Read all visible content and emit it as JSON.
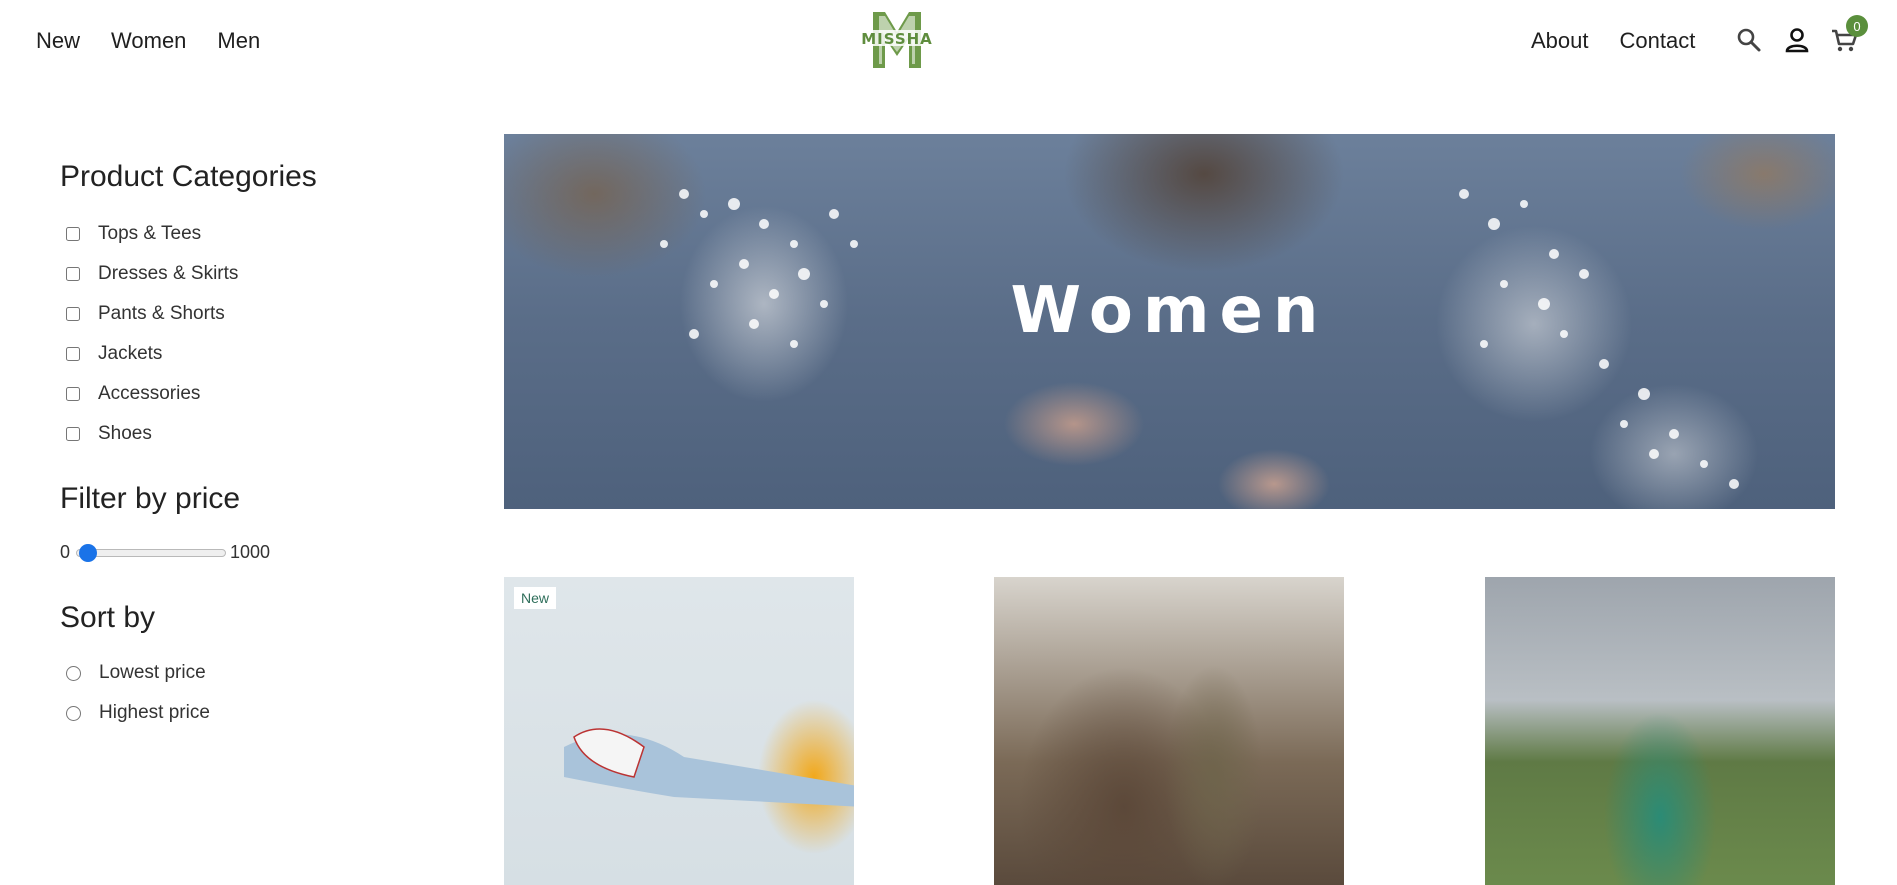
{
  "nav": {
    "left": [
      "New",
      "Women",
      "Men"
    ],
    "right": [
      "About",
      "Contact"
    ],
    "cart_count": "0",
    "logo_text": "MISSHA"
  },
  "icons": [
    "search-icon",
    "account-icon",
    "cart-icon"
  ],
  "sidebar": {
    "categories_title": "Product Categories",
    "categories": [
      "Tops & Tees",
      "Dresses & Skirts",
      "Pants & Shorts",
      "Jackets",
      "Accessories",
      "Shoes"
    ],
    "price_title": "Filter by price",
    "price_min": "0",
    "price_max": "1000",
    "sort_title": "Sort by",
    "sort_options": [
      "Lowest price",
      "Highest price"
    ]
  },
  "hero": {
    "title": "Women"
  },
  "products": [
    {
      "badge": "New"
    },
    {
      "badge": ""
    },
    {
      "badge": ""
    }
  ],
  "colors": {
    "accent": "#5a8f3c",
    "slider": "#1a73e8"
  }
}
